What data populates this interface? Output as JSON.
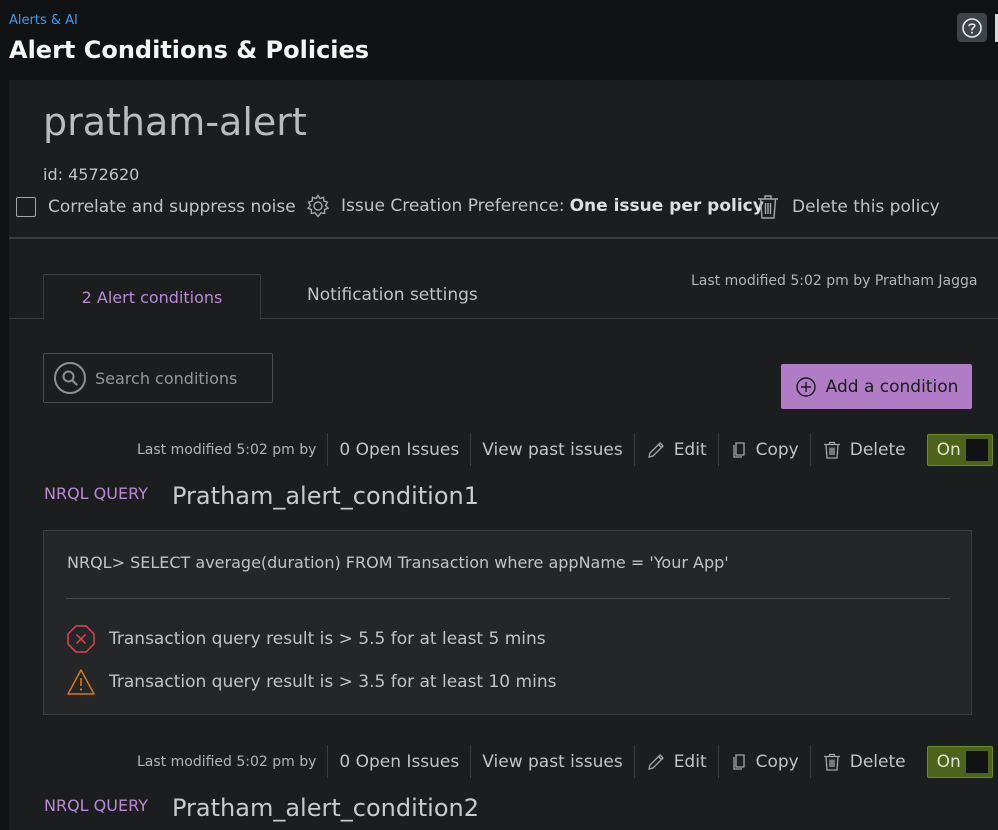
{
  "header": {
    "breadcrumb": "Alerts & AI",
    "title": "Alert Conditions & Policies",
    "help_icon": "question-circle-icon"
  },
  "policy": {
    "name": "pratham-alert",
    "id": "id: 4572620",
    "correlate_label": "Correlate and suppress noise",
    "correlate_checked": false,
    "preference_label": "Issue Creation Preference:",
    "preference_value": "One issue per policy",
    "delete_label": "Delete this policy"
  },
  "tabs": {
    "active": "2 Alert conditions",
    "inactive": "Notification settings",
    "last_modified": "Last modified 5:02 pm by Pratham Jagga"
  },
  "search": {
    "placeholder": "Search conditions"
  },
  "add_button": "Add a condition",
  "conditions": [
    {
      "modified": "Last modified 5:02 pm by",
      "open_issues": "0 Open Issues",
      "view_past": "View past issues",
      "edit": "Edit",
      "copy": "Copy",
      "delete": "Delete",
      "toggle": "On",
      "type": "NRQL QUERY",
      "name": "Pratham_alert_condition1",
      "query": "NRQL> SELECT average(duration) FROM Transaction where appName = 'Your App'",
      "critical": "Transaction query result is > 5.5 for at least 5 mins",
      "warning": "Transaction query result is > 3.5 for at least 10 mins"
    },
    {
      "modified": "Last modified 5:02 pm by",
      "open_issues": "0 Open Issues",
      "view_past": "View past issues",
      "edit": "Edit",
      "copy": "Copy",
      "delete": "Delete",
      "toggle": "On",
      "type": "NRQL QUERY",
      "name": "Pratham_alert_condition2"
    }
  ],
  "colors": {
    "accent_purple": "#b07cc6",
    "tab_purple": "#b98bd6",
    "toggle_green": "#4d6319",
    "link_blue": "#3c9cf0",
    "critical_red": "#e0444f",
    "warning_orange": "#d27a1b"
  }
}
